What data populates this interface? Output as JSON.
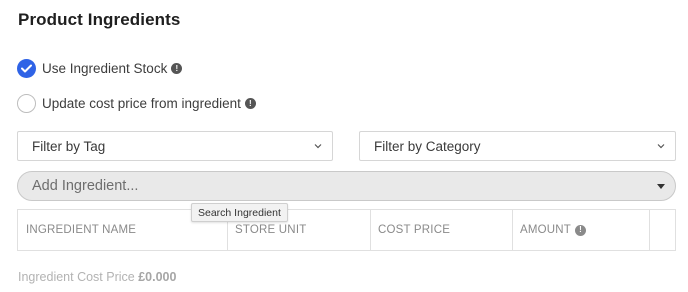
{
  "section": {
    "title": "Product Ingredients"
  },
  "options": [
    {
      "label": "Use Ingredient Stock",
      "checked": true,
      "info_icon": "info-icon"
    },
    {
      "label": "Update cost price from ingredient",
      "checked": false,
      "info_icon": "info-icon"
    }
  ],
  "filters": {
    "tag": {
      "selected": "Filter by Tag"
    },
    "category": {
      "selected": "Filter by Category"
    }
  },
  "add_ingredient": {
    "placeholder": "Add Ingredient..."
  },
  "tooltip": {
    "text": "Search Ingredient"
  },
  "table": {
    "headers": [
      "INGREDIENT NAME",
      "STORE UNIT",
      "COST PRICE",
      "AMOUNT",
      ""
    ]
  },
  "footer": {
    "label": "Ingredient Cost Price",
    "value": "£0.000"
  },
  "colors": {
    "accent": "#2f63e6"
  }
}
